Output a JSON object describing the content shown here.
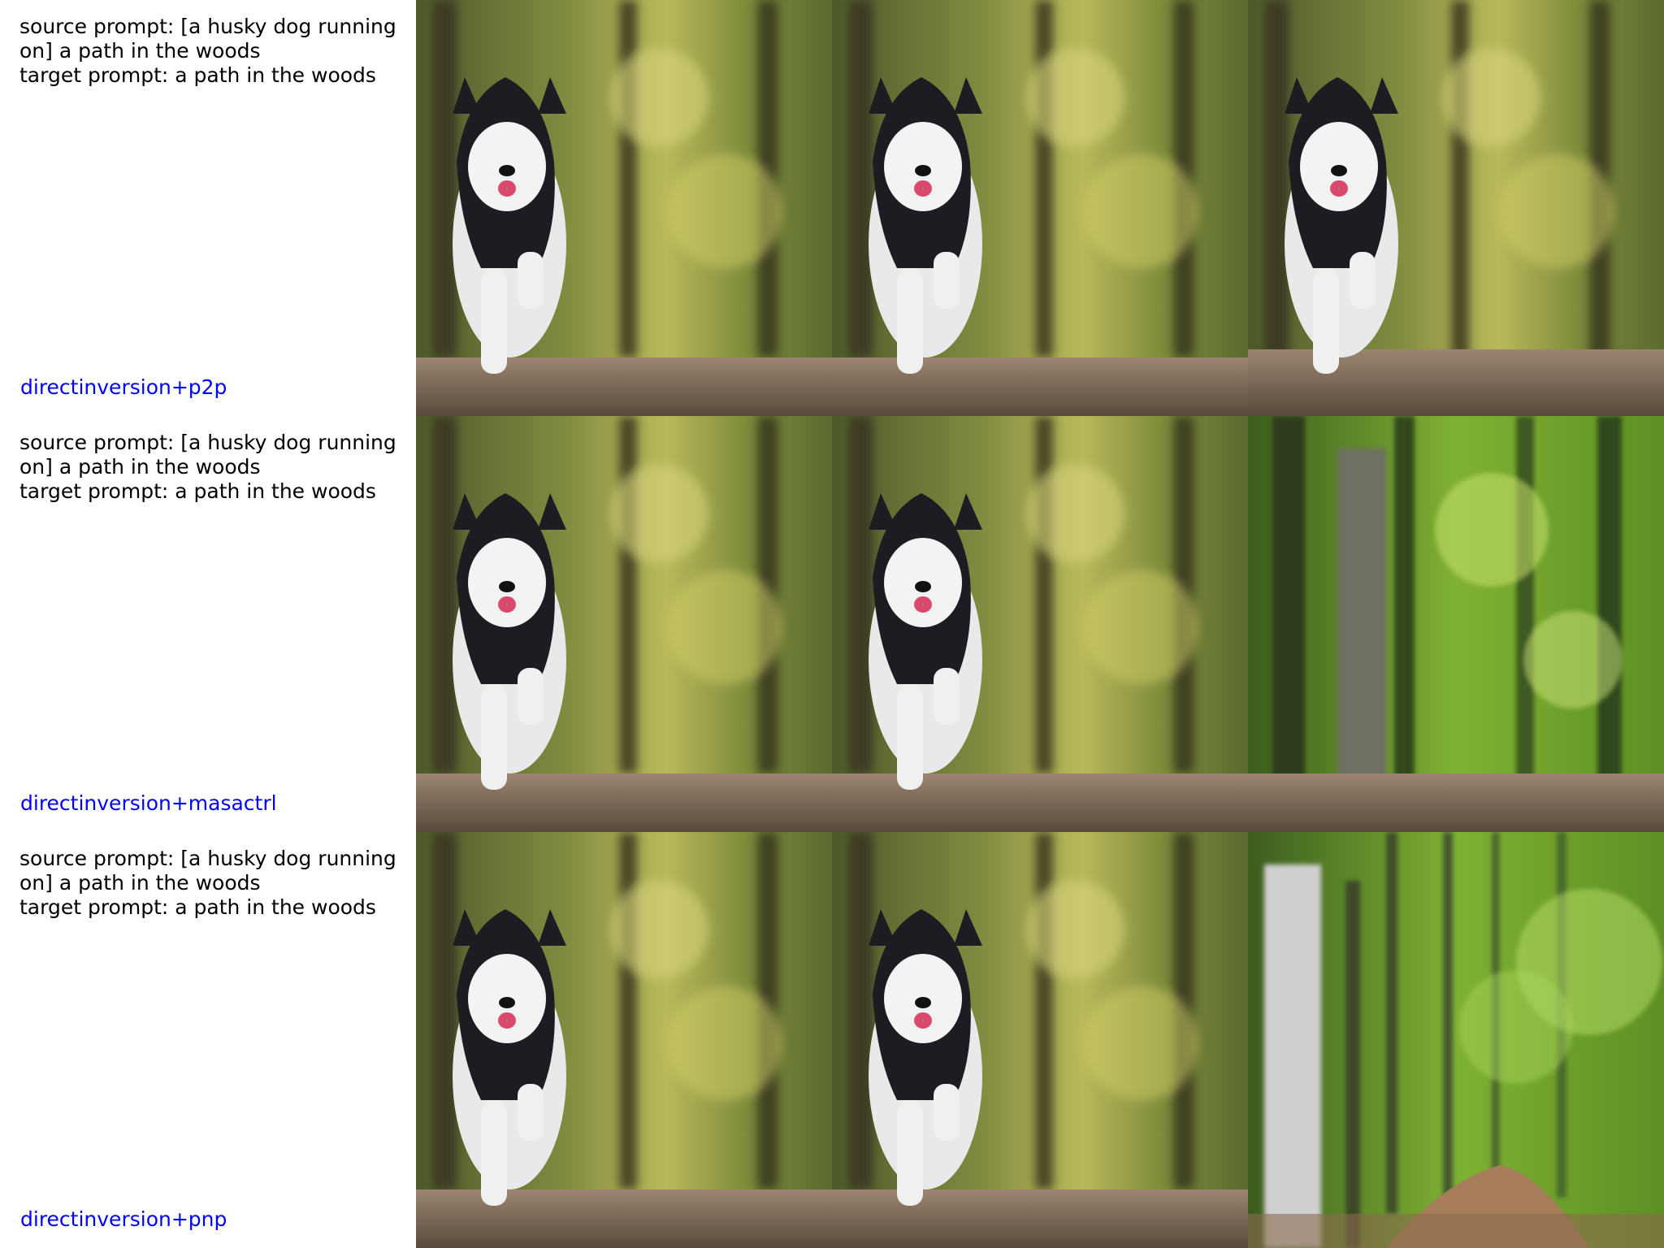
{
  "rows": [
    {
      "source_prompt": "source prompt: [a husky dog running on] a path in the woods",
      "target_prompt": "target prompt: a path in the woods",
      "method": "directinversion+p2p",
      "method_color": "#0000ff",
      "images": [
        "husky-source",
        "husky-reconstruction",
        "husky-edited"
      ]
    },
    {
      "source_prompt": "source prompt: [a husky dog running on] a path in the woods",
      "target_prompt": "target prompt: a path in the woods",
      "method": "directinversion+masactrl",
      "method_color": "#0000ff",
      "images": [
        "husky-source",
        "husky-reconstruction",
        "woods-edited-ghost"
      ]
    },
    {
      "source_prompt": "source prompt: [a husky dog running on] a path in the woods",
      "target_prompt": "target prompt: a path in the woods",
      "method": "directinversion+pnp",
      "method_color": "#0000ff",
      "images": [
        "husky-source",
        "husky-reconstruction",
        "woods-edited-path"
      ]
    }
  ],
  "colors": {
    "text": "#000000",
    "method_label": "#0000ff",
    "background": "#ffffff"
  }
}
